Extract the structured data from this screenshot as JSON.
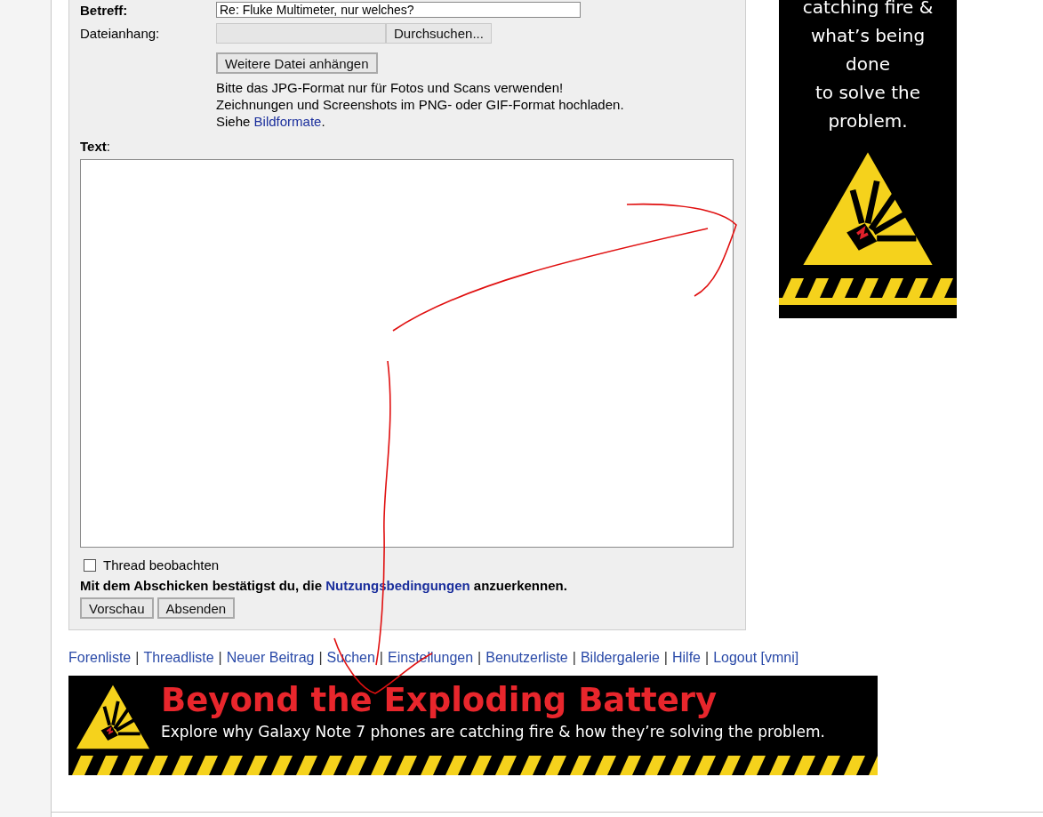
{
  "form": {
    "subject": {
      "label": "Betreff:",
      "value": "Re: Fluke Multimeter, nur welches?"
    },
    "attachment": {
      "label": "Dateianhang:",
      "browse_button": "Durchsuchen...",
      "more_button": "Weitere Datei anhängen"
    },
    "hint": {
      "before": "Bitte das JPG-Format nur für Fotos und Scans verwenden! Zeichnungen und Screenshots im PNG- oder GIF-Format hochladen. Siehe ",
      "link": "Bildformate",
      "after": "."
    },
    "text_label": "Text",
    "text_label_suffix": ":",
    "watch": {
      "label": "Thread beobachten",
      "checked": false
    },
    "terms": {
      "before": "Mit dem Abschicken bestätigst du, die ",
      "link": "Nutzungsbedingungen",
      "after": " anzuerkennen."
    },
    "buttons": [
      "Vorschau",
      "Absenden"
    ]
  },
  "side_ad": {
    "lines": [
      "catching fire &",
      "what’s being",
      "done",
      "to solve the",
      "problem."
    ]
  },
  "nav": [
    {
      "label": "Forenliste",
      "separator": "|"
    },
    {
      "label": "Threadliste",
      "separator": "|"
    },
    {
      "label": "Neuer Beitrag",
      "separator": "|"
    },
    {
      "label": "Suchen",
      "separator": "|"
    },
    {
      "label": "Einstellungen",
      "separator": "|"
    },
    {
      "label": "Benutzerliste",
      "separator": "|"
    },
    {
      "label": "Bildergalerie",
      "separator": "|"
    },
    {
      "label": "Hilfe",
      "separator": "|"
    },
    {
      "label": "Logout [vmni]"
    }
  ],
  "banner": {
    "title": "Beyond the Exploding Battery",
    "subtitle": "Explore why Galaxy Note 7 phones are catching fire & how they’re solving the problem."
  }
}
